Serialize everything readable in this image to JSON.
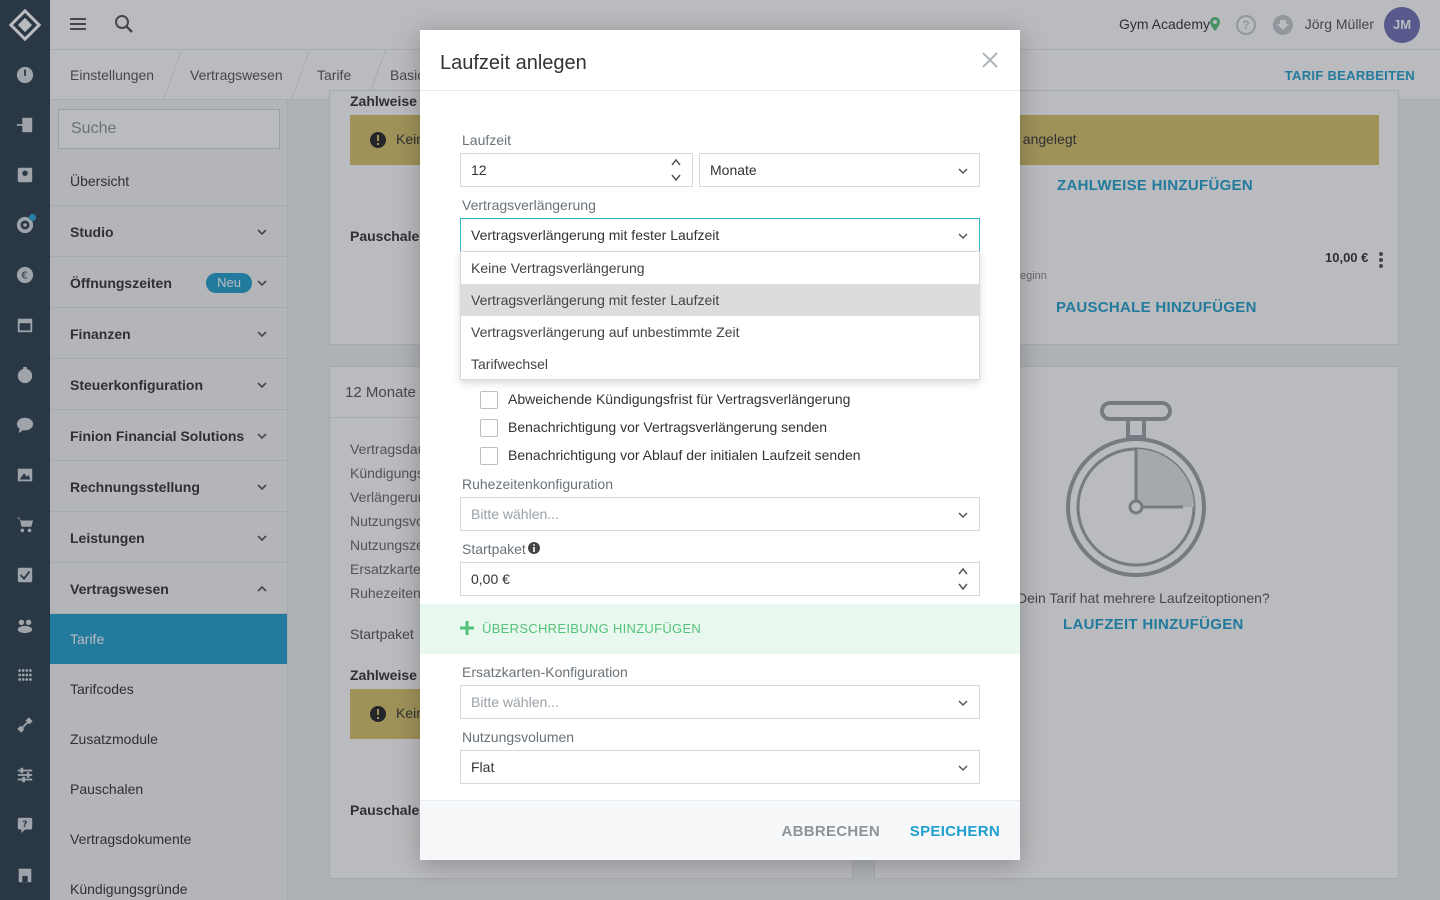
{
  "topbar": {
    "studio": "Gym Academy",
    "user_name": "Jörg Müller",
    "avatar_initials": "JM",
    "help_glyph": "?"
  },
  "breadcrumb": {
    "items": [
      "Einstellungen",
      "Vertragswesen",
      "Tarife",
      "Basic"
    ],
    "action": "TARIF BEARBEITEN"
  },
  "sidebar": {
    "search_placeholder": "Suche",
    "items": [
      {
        "label": "Übersicht"
      },
      {
        "label": "Studio"
      },
      {
        "label": "Öffnungszeiten",
        "badge": "Neu"
      },
      {
        "label": "Finanzen"
      },
      {
        "label": "Steuerkonfiguration"
      },
      {
        "label": "Finion Financial Solutions"
      },
      {
        "label": "Rechnungsstellung"
      },
      {
        "label": "Leistungen"
      },
      {
        "label": "Vertragswesen"
      },
      {
        "label": "Tarife"
      },
      {
        "label": "Tarifcodes"
      },
      {
        "label": "Zusatzmodule"
      },
      {
        "label": "Pauschalen"
      },
      {
        "label": "Vertragsdokumente"
      },
      {
        "label": "Kündigungsgründe"
      }
    ]
  },
  "background": {
    "zahlweise_label": "Zahlweise",
    "warning_prefix": "Kein",
    "warning_suffix": "ise angelegt",
    "zahlweise_add": "ZAHLWEISE HINZUFÜGEN",
    "pauschalen_label": "Pauschalen",
    "price": "10,00 €",
    "price_note": "eginn",
    "pauschale_add": "PAUSCHALE HINZUFÜGEN",
    "term_card_title": "12 Monate",
    "term_rows": [
      "Vertragsdau",
      "Kündigungs",
      "Verlängerun",
      "Nutzungsvo",
      "Nutzungsze",
      "Ersatzkarter",
      "Ruhezeiten"
    ],
    "startpaket_label": "Startpaket",
    "zahlweise_label_2": "Zahlweise",
    "warning_prefix_2": "Kein",
    "pauschalen_label_2": "Pauschalen",
    "multi_question": "Dein Tarif hat mehrere Laufzeitoptionen?",
    "laufzeit_add": "LAUFZEIT HINZUFÜGEN"
  },
  "modal": {
    "title": "Laufzeit anlegen",
    "laufzeit_label": "Laufzeit",
    "laufzeit_value": "12",
    "laufzeit_unit": "Monate",
    "verlaengerung_label": "Vertragsverlängerung",
    "verlaengerung_value": "Vertragsverlängerung mit fester Laufzeit",
    "dropdown_options": [
      "Keine Vertragsverlängerung",
      "Vertragsverlängerung mit fester Laufzeit",
      "Vertragsverlängerung auf unbestimmte Zeit",
      "Tarifwechsel"
    ],
    "selected_option_index": 1,
    "checkboxes": [
      {
        "label": "Abweichende Kündigungsfrist für Vertragsverlängerung",
        "checked": false
      },
      {
        "label": "Benachrichtigung vor Vertragsverlängerung senden",
        "checked": false
      },
      {
        "label": "Benachrichtigung vor Ablauf der initialen Laufzeit senden",
        "checked": false
      }
    ],
    "ruhezeiten_label": "Ruhezeitenkonfiguration",
    "ruhezeiten_placeholder": "Bitte wählen...",
    "startpaket_label": "Startpaket",
    "startpaket_value": "0,00 €",
    "override_label": "ÜBERSCHREIBUNG HINZUFÜGEN",
    "ersatzkarten_label": "Ersatzkarten-Konfiguration",
    "ersatzkarten_placeholder": "Bitte wählen...",
    "nutzungsvolumen_label": "Nutzungsvolumen",
    "nutzungsvolumen_value": "Flat",
    "cancel": "ABBRECHEN",
    "save": "SPEICHERN"
  },
  "colors": {
    "primary": "#1f9fce",
    "rail": "#2b3f4e",
    "warning": "#d8c36a",
    "success": "#54c27a",
    "avatar": "#6f6fb6"
  }
}
